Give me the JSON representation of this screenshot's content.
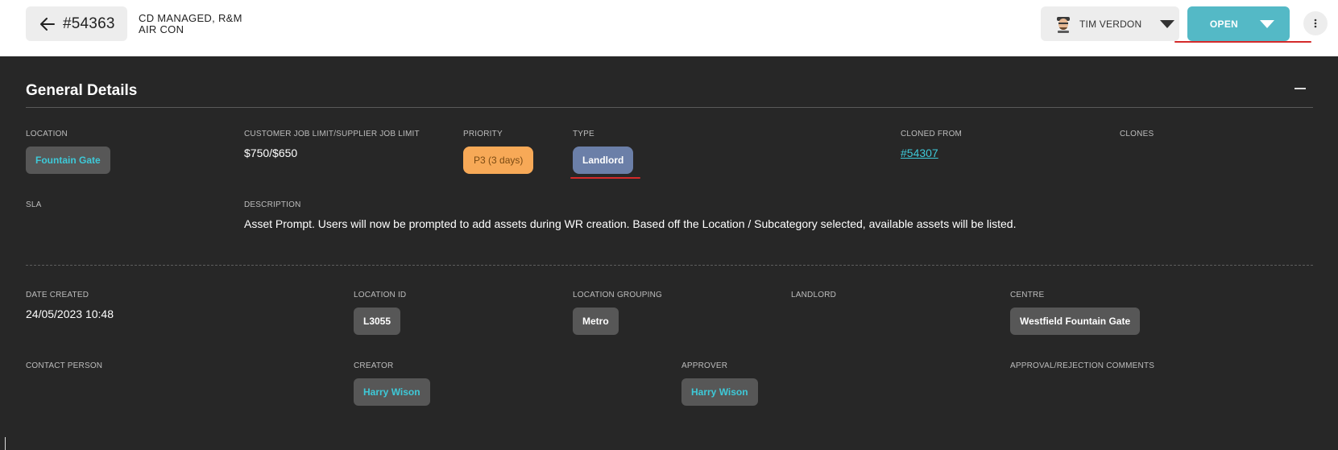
{
  "header": {
    "job_number": "#54363",
    "title_line1": "CD MANAGED, R&M",
    "title_line2": "AIR CON",
    "user_name": "TIM VERDON",
    "status": "OPEN"
  },
  "section": {
    "title": "General Details"
  },
  "fields": {
    "location": {
      "label": "LOCATION",
      "value": "Fountain Gate"
    },
    "job_limit": {
      "label": "CUSTOMER JOB LIMIT/SUPPLIER JOB LIMIT",
      "value": "$750/$650"
    },
    "priority": {
      "label": "PRIORITY",
      "value": "P3 (3 days)"
    },
    "type": {
      "label": "TYPE",
      "value": "Landlord"
    },
    "cloned_from": {
      "label": "CLONED FROM",
      "value": "#54307"
    },
    "clones": {
      "label": "CLONES"
    },
    "sla": {
      "label": "SLA"
    },
    "description": {
      "label": "DESCRIPTION",
      "value": "Asset Prompt. Users will now be prompted to add assets during WR creation. Based off the Location / Subcategory selected, available assets will be listed."
    },
    "date_created": {
      "label": "DATE CREATED",
      "value": "24/05/2023 10:48"
    },
    "location_id": {
      "label": "LOCATION ID",
      "value": "L3055"
    },
    "location_grouping": {
      "label": "LOCATION GROUPING",
      "value": "Metro"
    },
    "landlord": {
      "label": "LANDLORD"
    },
    "centre": {
      "label": "CENTRE",
      "value": "Westfield Fountain Gate"
    },
    "contact_person": {
      "label": "CONTACT PERSON"
    },
    "creator": {
      "label": "CREATOR",
      "value": "Harry Wison"
    },
    "approver": {
      "label": "APPROVER",
      "value": "Harry Wison"
    },
    "approval_comments": {
      "label": "APPROVAL/REJECTION COMMENTS"
    }
  },
  "colors": {
    "accent": "#54b9c6",
    "link": "#3ec9d8",
    "priority": "#f7a957",
    "type": "#6b7fa8",
    "annotation": "#d42a2a",
    "background": "#272727"
  }
}
